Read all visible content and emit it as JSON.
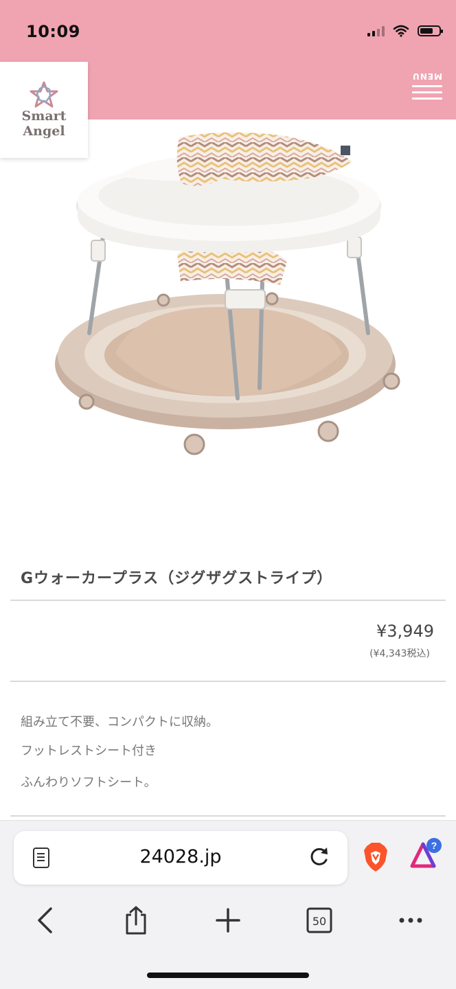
{
  "status_bar": {
    "time": "10:09"
  },
  "header": {
    "logo_line1": "Smart",
    "logo_line2": "Angel",
    "menu_label": "MENU"
  },
  "product": {
    "name": "Gウォーカープラス（ジグザグストライプ）",
    "price": "¥3,949",
    "price_with_tax": "(¥4,343税込)",
    "features": [
      "組み立て不要、コンパクトに収納。",
      "フットレストシート付き",
      "ふんわりソフトシート。"
    ]
  },
  "browser": {
    "url": "24028.jp",
    "tab_count": "50",
    "rewards_badge": "?"
  },
  "colors": {
    "header_pink": "#f0a3b1",
    "walker_beige": "#cdb6a6",
    "brave_orange": "#fb542b"
  }
}
